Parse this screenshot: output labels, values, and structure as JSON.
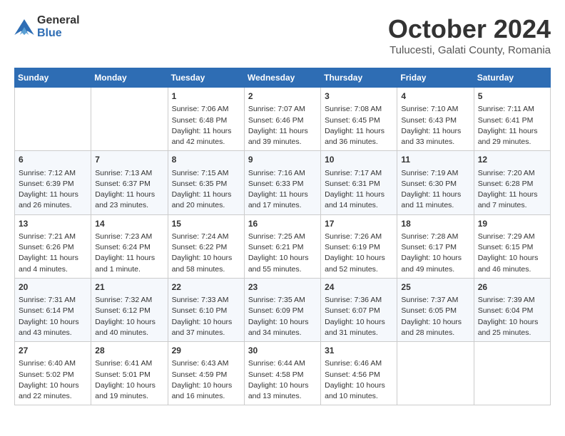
{
  "header": {
    "logo_line1": "General",
    "logo_line2": "Blue",
    "month_title": "October 2024",
    "subtitle": "Tulucesti, Galati County, Romania"
  },
  "days_of_week": [
    "Sunday",
    "Monday",
    "Tuesday",
    "Wednesday",
    "Thursday",
    "Friday",
    "Saturday"
  ],
  "weeks": [
    [
      {
        "day": "",
        "sunrise": "",
        "sunset": "",
        "daylight": ""
      },
      {
        "day": "",
        "sunrise": "",
        "sunset": "",
        "daylight": ""
      },
      {
        "day": "1",
        "sunrise": "Sunrise: 7:06 AM",
        "sunset": "Sunset: 6:48 PM",
        "daylight": "Daylight: 11 hours and 42 minutes."
      },
      {
        "day": "2",
        "sunrise": "Sunrise: 7:07 AM",
        "sunset": "Sunset: 6:46 PM",
        "daylight": "Daylight: 11 hours and 39 minutes."
      },
      {
        "day": "3",
        "sunrise": "Sunrise: 7:08 AM",
        "sunset": "Sunset: 6:45 PM",
        "daylight": "Daylight: 11 hours and 36 minutes."
      },
      {
        "day": "4",
        "sunrise": "Sunrise: 7:10 AM",
        "sunset": "Sunset: 6:43 PM",
        "daylight": "Daylight: 11 hours and 33 minutes."
      },
      {
        "day": "5",
        "sunrise": "Sunrise: 7:11 AM",
        "sunset": "Sunset: 6:41 PM",
        "daylight": "Daylight: 11 hours and 29 minutes."
      }
    ],
    [
      {
        "day": "6",
        "sunrise": "Sunrise: 7:12 AM",
        "sunset": "Sunset: 6:39 PM",
        "daylight": "Daylight: 11 hours and 26 minutes."
      },
      {
        "day": "7",
        "sunrise": "Sunrise: 7:13 AM",
        "sunset": "Sunset: 6:37 PM",
        "daylight": "Daylight: 11 hours and 23 minutes."
      },
      {
        "day": "8",
        "sunrise": "Sunrise: 7:15 AM",
        "sunset": "Sunset: 6:35 PM",
        "daylight": "Daylight: 11 hours and 20 minutes."
      },
      {
        "day": "9",
        "sunrise": "Sunrise: 7:16 AM",
        "sunset": "Sunset: 6:33 PM",
        "daylight": "Daylight: 11 hours and 17 minutes."
      },
      {
        "day": "10",
        "sunrise": "Sunrise: 7:17 AM",
        "sunset": "Sunset: 6:31 PM",
        "daylight": "Daylight: 11 hours and 14 minutes."
      },
      {
        "day": "11",
        "sunrise": "Sunrise: 7:19 AM",
        "sunset": "Sunset: 6:30 PM",
        "daylight": "Daylight: 11 hours and 11 minutes."
      },
      {
        "day": "12",
        "sunrise": "Sunrise: 7:20 AM",
        "sunset": "Sunset: 6:28 PM",
        "daylight": "Daylight: 11 hours and 7 minutes."
      }
    ],
    [
      {
        "day": "13",
        "sunrise": "Sunrise: 7:21 AM",
        "sunset": "Sunset: 6:26 PM",
        "daylight": "Daylight: 11 hours and 4 minutes."
      },
      {
        "day": "14",
        "sunrise": "Sunrise: 7:23 AM",
        "sunset": "Sunset: 6:24 PM",
        "daylight": "Daylight: 11 hours and 1 minute."
      },
      {
        "day": "15",
        "sunrise": "Sunrise: 7:24 AM",
        "sunset": "Sunset: 6:22 PM",
        "daylight": "Daylight: 10 hours and 58 minutes."
      },
      {
        "day": "16",
        "sunrise": "Sunrise: 7:25 AM",
        "sunset": "Sunset: 6:21 PM",
        "daylight": "Daylight: 10 hours and 55 minutes."
      },
      {
        "day": "17",
        "sunrise": "Sunrise: 7:26 AM",
        "sunset": "Sunset: 6:19 PM",
        "daylight": "Daylight: 10 hours and 52 minutes."
      },
      {
        "day": "18",
        "sunrise": "Sunrise: 7:28 AM",
        "sunset": "Sunset: 6:17 PM",
        "daylight": "Daylight: 10 hours and 49 minutes."
      },
      {
        "day": "19",
        "sunrise": "Sunrise: 7:29 AM",
        "sunset": "Sunset: 6:15 PM",
        "daylight": "Daylight: 10 hours and 46 minutes."
      }
    ],
    [
      {
        "day": "20",
        "sunrise": "Sunrise: 7:31 AM",
        "sunset": "Sunset: 6:14 PM",
        "daylight": "Daylight: 10 hours and 43 minutes."
      },
      {
        "day": "21",
        "sunrise": "Sunrise: 7:32 AM",
        "sunset": "Sunset: 6:12 PM",
        "daylight": "Daylight: 10 hours and 40 minutes."
      },
      {
        "day": "22",
        "sunrise": "Sunrise: 7:33 AM",
        "sunset": "Sunset: 6:10 PM",
        "daylight": "Daylight: 10 hours and 37 minutes."
      },
      {
        "day": "23",
        "sunrise": "Sunrise: 7:35 AM",
        "sunset": "Sunset: 6:09 PM",
        "daylight": "Daylight: 10 hours and 34 minutes."
      },
      {
        "day": "24",
        "sunrise": "Sunrise: 7:36 AM",
        "sunset": "Sunset: 6:07 PM",
        "daylight": "Daylight: 10 hours and 31 minutes."
      },
      {
        "day": "25",
        "sunrise": "Sunrise: 7:37 AM",
        "sunset": "Sunset: 6:05 PM",
        "daylight": "Daylight: 10 hours and 28 minutes."
      },
      {
        "day": "26",
        "sunrise": "Sunrise: 7:39 AM",
        "sunset": "Sunset: 6:04 PM",
        "daylight": "Daylight: 10 hours and 25 minutes."
      }
    ],
    [
      {
        "day": "27",
        "sunrise": "Sunrise: 6:40 AM",
        "sunset": "Sunset: 5:02 PM",
        "daylight": "Daylight: 10 hours and 22 minutes."
      },
      {
        "day": "28",
        "sunrise": "Sunrise: 6:41 AM",
        "sunset": "Sunset: 5:01 PM",
        "daylight": "Daylight: 10 hours and 19 minutes."
      },
      {
        "day": "29",
        "sunrise": "Sunrise: 6:43 AM",
        "sunset": "Sunset: 4:59 PM",
        "daylight": "Daylight: 10 hours and 16 minutes."
      },
      {
        "day": "30",
        "sunrise": "Sunrise: 6:44 AM",
        "sunset": "Sunset: 4:58 PM",
        "daylight": "Daylight: 10 hours and 13 minutes."
      },
      {
        "day": "31",
        "sunrise": "Sunrise: 6:46 AM",
        "sunset": "Sunset: 4:56 PM",
        "daylight": "Daylight: 10 hours and 10 minutes."
      },
      {
        "day": "",
        "sunrise": "",
        "sunset": "",
        "daylight": ""
      },
      {
        "day": "",
        "sunrise": "",
        "sunset": "",
        "daylight": ""
      }
    ]
  ]
}
